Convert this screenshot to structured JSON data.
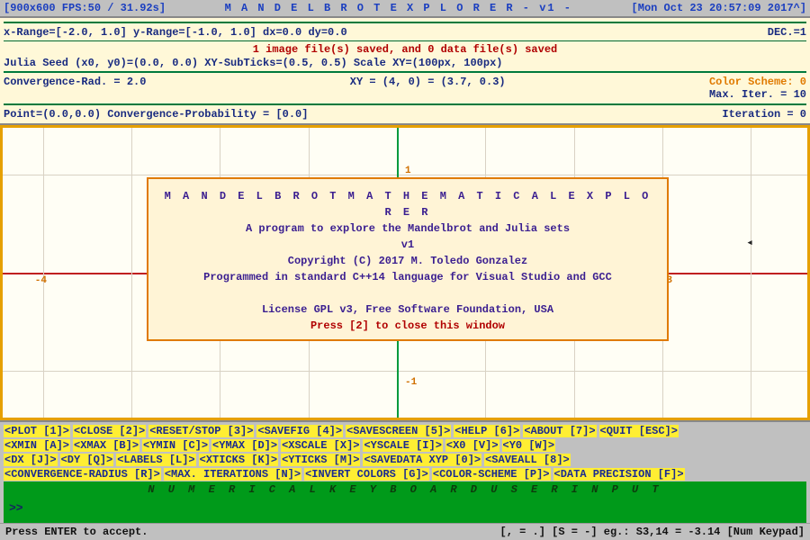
{
  "title_bar": {
    "left": "[900x600 FPS:50 / 31.92s]",
    "center": "M A N D E L B R O T    E X P L O R E R   - v1 -",
    "right": "[Mon Oct 23 20:57:09 2017^]"
  },
  "info": {
    "range_row": "x-Range=[-2.0, 1.0] y-Range=[-1.0, 1.0] dx=0.0 dy=0.0",
    "dec": "DEC.=1",
    "files_saved": "1 image file(s) saved, and 0 data file(s) saved",
    "julia": "Julia Seed (x0, y0)=(0.0, 0.0) XY-SubTicks=(0.5, 0.5) Scale XY=(100px, 100px)",
    "conv_rad": "Convergence-Rad. = 2.0",
    "xy": "XY = (4, 0) = (3.7, 0.3)",
    "color_scheme": "Color Scheme: 0",
    "max_iter": "Max. Iter. = 10",
    "point": "Point=(0.0,0.0)  Convergence-Probability = [0.0]",
    "iteration": "Iteration = 0"
  },
  "ticks": {
    "xneg4": "-4",
    "x3": "3",
    "y1": "1",
    "yneg1": "-1"
  },
  "about": {
    "title": "M A N D E L B R O T    M A T H E M A T I C A L    E X P L O R E R",
    "subtitle": "A program to explore the Mandelbrot and Julia sets",
    "version": "v1",
    "copyright": "Copyright (C) 2017 M. Toledo Gonzalez",
    "lang": "Programmed in standard C++14 language for Visual Studio and GCC",
    "license": "License GPL v3, Free Software Foundation, USA",
    "close": "Press [2] to close this window"
  },
  "commands": {
    "row1": [
      "<PLOT [1]>",
      "<CLOSE [2]>",
      "<RESET/STOP [3]>",
      "<SAVEFIG [4]>",
      "<SAVESCREEN [5]>",
      "<HELP [6]>",
      "<ABOUT [7]>",
      "<QUIT [ESC]>"
    ],
    "row2": [
      "<XMIN [A]>",
      "<XMAX [B]>",
      "<YMIN [C]>",
      "<YMAX [D]>",
      "<XSCALE [X]>",
      "<YSCALE [I]>",
      "<X0 [V]>",
      "<Y0 [W]>"
    ],
    "row3": [
      "<DX [J]>",
      "<DY [Q]>",
      "<LABELS [L]>",
      "<XTICKS [K]>",
      "<YTICKS [M]>",
      "<SAVEDATA XYP [0]>",
      "<SAVEALL [8]>"
    ],
    "row4": [
      "<CONVERGENCE-RADIUS [R]>",
      "<MAX. ITERATIONS [N]>",
      "<INVERT COLORS [G]>",
      "<COLOR-SCHEME [P]>",
      "<DATA PRECISION [F]>"
    ]
  },
  "input": {
    "heading": "N U M E R I C A L   K E Y B O A R D   U S E R   I N P U T",
    "prompt": ">>"
  },
  "footer": {
    "left": "Press ENTER to accept.",
    "right": "[, = .] [S = -] eg.: S3,14 = -3.14 [Num Keypad]"
  }
}
